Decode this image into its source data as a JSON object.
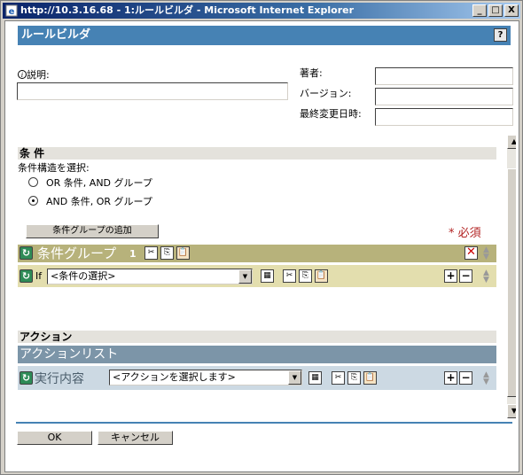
{
  "window": {
    "title": "http://10.3.16.68 - 1:ルールビルダ - Microsoft Internet Explorer",
    "minimize": "_",
    "maximize": "□",
    "close": "X"
  },
  "header": {
    "title": "ルールビルダ",
    "help": "?"
  },
  "form": {
    "description_label": "説明:",
    "author_label": "著者:",
    "version_label": "バージョン:",
    "modified_label": "最終変更日時:"
  },
  "conditions": {
    "section_title": "条 件",
    "structure_label": "条件構造を選択:",
    "option1": "OR 条件, AND グループ",
    "option2": "AND 条件, OR グループ",
    "add_group_button": "条件グループの追加",
    "required": "* 必須",
    "group_title": "条件グループ",
    "group_number": "1",
    "if_label": "If",
    "condition_select": "<条件の選択>"
  },
  "actions": {
    "section_title": "アクション",
    "list_title": "アクションリスト",
    "do_label": "実行内容",
    "action_select": "<アクションを選択します>"
  },
  "footer": {
    "ok": "OK",
    "cancel": "キャンセル"
  }
}
